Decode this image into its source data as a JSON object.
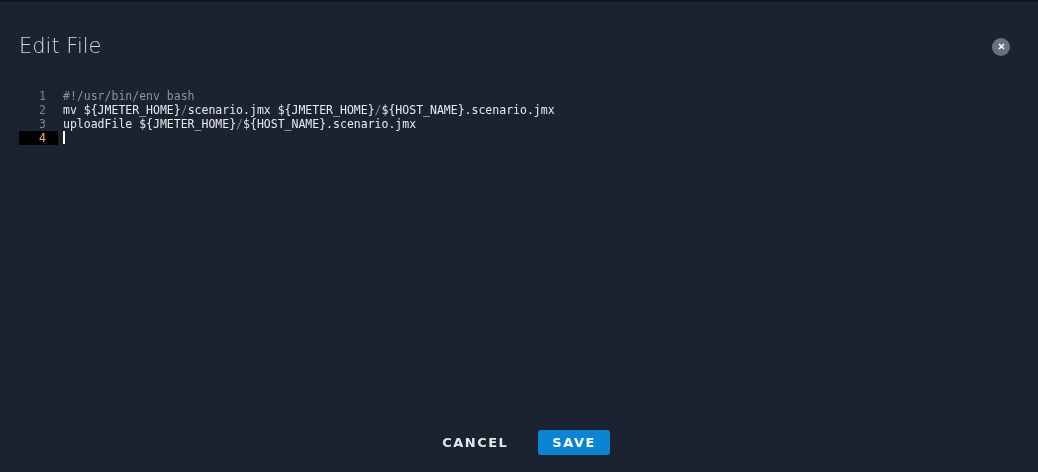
{
  "dialog": {
    "title": "Edit File"
  },
  "editor": {
    "lines": [
      {
        "number": "1",
        "active": false,
        "tokens": [
          {
            "kind": "comment",
            "text": "#!/usr/bin/env bash"
          }
        ]
      },
      {
        "number": "2",
        "active": false,
        "tokens": [
          {
            "kind": "plain",
            "text": "mv ${JMETER_HOME}"
          },
          {
            "kind": "operator",
            "text": "/"
          },
          {
            "kind": "plain",
            "text": "scenario.jmx ${JMETER_HOME}"
          },
          {
            "kind": "operator",
            "text": "/"
          },
          {
            "kind": "plain",
            "text": "${HOST_NAME}.scenario.jmx"
          }
        ]
      },
      {
        "number": "3",
        "active": false,
        "tokens": [
          {
            "kind": "plain",
            "text": "uploadFile ${JMETER_HOME}"
          },
          {
            "kind": "operator",
            "text": "/"
          },
          {
            "kind": "plain",
            "text": "${HOST_NAME}.scenario.jmx"
          }
        ]
      },
      {
        "number": "4",
        "active": true
      }
    ]
  },
  "buttons": [
    {
      "kind": "text",
      "label": "CANCEL"
    },
    {
      "kind": "primary",
      "label": "SAVE"
    }
  ]
}
